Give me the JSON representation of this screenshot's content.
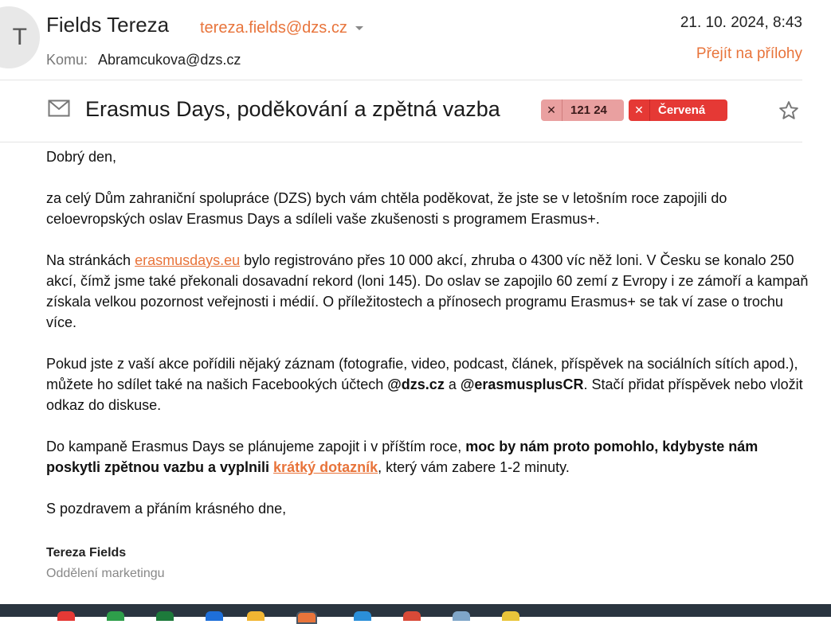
{
  "sender": {
    "avatar_initial": "T",
    "name": "Fields Tereza",
    "email": "tereza.fields@dzs.cz"
  },
  "recipient": {
    "label": "Komu:",
    "value": "Abramcukova@dzs.cz"
  },
  "date": "21. 10. 2024, 8:43",
  "attachments_link": "Přejít na přílohy",
  "subject": "Erasmus Days, poděkování a zpětná vazba",
  "tags": [
    {
      "label": "121 24",
      "color": "#e9a0a0"
    },
    {
      "label": "Červená",
      "color": "#e53935"
    }
  ],
  "body": {
    "greeting": "Dobrý den,",
    "p1": "za celý Dům zahraniční spolupráce (DZS) bych vám chtěla poděkovat, že jste se v letošním roce zapojili do celoevropských oslav Erasmus Days a sdíleli vaše zkušenosti s programem Erasmus+.",
    "p2_a": "Na stránkách ",
    "p2_link": "erasmusdays.eu",
    "p2_b": " bylo registrováno přes 10 000 akcí, zhruba o 4300 víc něž loni. V Česku se konalo 250 akcí, čímž jsme také překonali dosavadní rekord (loni 145). Do oslav se zapojilo 60 zemí z Evropy i ze zámoří a kampaň získala velkou pozornost veřejnosti i médií. O příležitostech a přínosech programu Erasmus+ se tak ví zase o trochu více.",
    "p3_a": "Pokud jste z vaší akce pořídili nějaký záznam (fotografie, video, podcast, článek, příspěvek na sociálních sítích apod.), můžete ho sdílet také na našich Facebookých účtech ",
    "p3_handle1": "@dzs.cz",
    "p3_b": " a ",
    "p3_handle2": "@erasmusplusCR",
    "p3_c": ". Stačí přidat příspěvek nebo vložit odkaz do diskuse.",
    "p4_a": "Do kampaně Erasmus Days se plánujeme zapojit i v příštím roce, ",
    "p4_bold": "moc by nám proto pomohlo, kdybyste nám poskytli zpětnou vazbu a vyplnili ",
    "p4_link": "krátký dotazník",
    "p4_c": ", který vám zabere 1-2 minuty.",
    "closing": "S pozdravem a přáním krásného dne,"
  },
  "signature": {
    "name": "Tereza Fields",
    "department": "Oddělení marketingu"
  },
  "colors": {
    "accent": "#e8743b",
    "taskbar": "#2a3540"
  },
  "icons": [
    "mail-icon",
    "star-icon",
    "caret-down-icon"
  ]
}
